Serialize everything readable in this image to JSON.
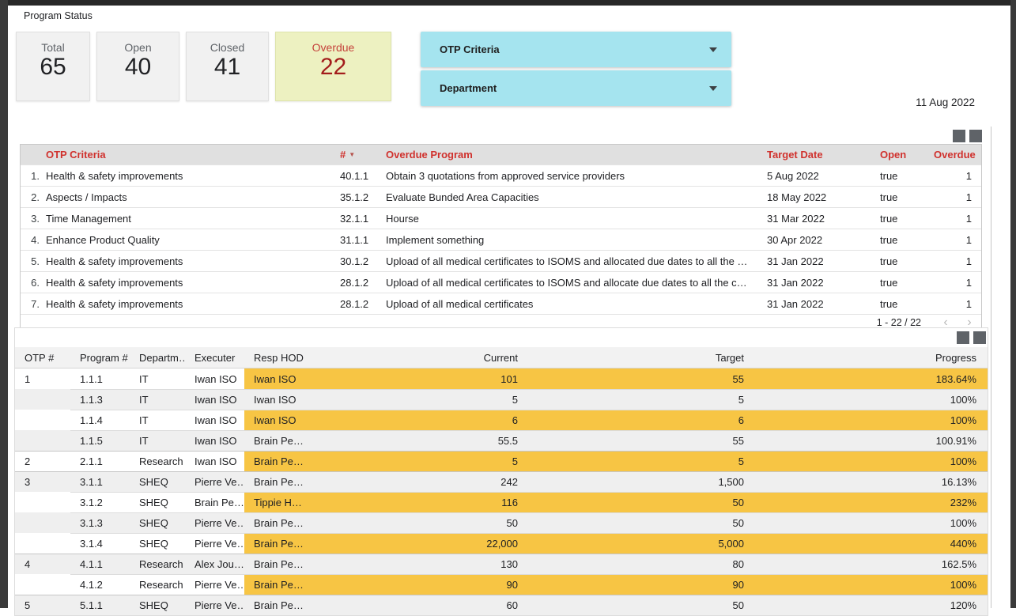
{
  "page": {
    "title": "Program Status",
    "date": "11 Aug 2022"
  },
  "scorecards": [
    {
      "label": "Total",
      "value": "65",
      "variant": "default"
    },
    {
      "label": "Open",
      "value": "40",
      "variant": "default"
    },
    {
      "label": "Closed",
      "value": "41",
      "variant": "default"
    },
    {
      "label": "Overdue",
      "value": "22",
      "variant": "overdue"
    }
  ],
  "filters": [
    {
      "label": "OTP Criteria"
    },
    {
      "label": "Department"
    }
  ],
  "overdue_table": {
    "headers": {
      "criteria": "OTP Criteria",
      "hash": "#",
      "program": "Overdue Program",
      "target_date": "Target Date",
      "open": "Open",
      "overdue": "Overdue"
    },
    "sort_icon": "▼",
    "rows": [
      {
        "num": "1.",
        "criteria": "Health & safety improvements",
        "hash": "40.1.1",
        "program": "Obtain 3 quotations from approved service providers",
        "target_date": "5 Aug 2022",
        "open": "true",
        "overdue": "1"
      },
      {
        "num": "2.",
        "criteria": "Aspects / Impacts",
        "hash": "35.1.2",
        "program": "Evaluate Bunded Area Capacities",
        "target_date": "18 May 2022",
        "open": "true",
        "overdue": "1"
      },
      {
        "num": "3.",
        "criteria": "Time Management",
        "hash": "32.1.1",
        "program": "Hourse",
        "target_date": "31 Mar 2022",
        "open": "true",
        "overdue": "1"
      },
      {
        "num": "4.",
        "criteria": "Enhance Product Quality",
        "hash": "31.1.1",
        "program": "Implement something",
        "target_date": "30 Apr 2022",
        "open": "true",
        "overdue": "1"
      },
      {
        "num": "5.",
        "criteria": "Health & safety improvements",
        "hash": "30.1.2",
        "program": "Upload of all medical certificates to ISOMS and allocated due dates to all the …",
        "target_date": "31 Jan 2022",
        "open": "true",
        "overdue": "1"
      },
      {
        "num": "6.",
        "criteria": "Health & safety improvements",
        "hash": "28.1.2",
        "program": "Upload of all medical certificates to ISOMS and allocate due dates to all the c…",
        "target_date": "31 Jan 2022",
        "open": "true",
        "overdue": "1"
      },
      {
        "num": "7.",
        "criteria": "Health & safety improvements",
        "hash": "28.1.2",
        "program": "Upload of all medical certificates",
        "target_date": "31 Jan 2022",
        "open": "true",
        "overdue": "1"
      }
    ],
    "pagination": {
      "range": "1 - 22 / 22",
      "prev": "‹",
      "next": "›"
    }
  },
  "progress_table": {
    "headers": {
      "otp": "OTP #",
      "program": "Program #",
      "department": "Departm…",
      "executer": "Executer",
      "resp_hod": "Resp HOD",
      "current": "Current",
      "target": "Target",
      "progress": "Progress"
    },
    "rows": [
      {
        "otp": "1",
        "program": "1.1.1",
        "department": "IT",
        "executer": "Iwan ISO",
        "resp_hod": "Iwan ISO",
        "current": "101",
        "target": "55",
        "progress": "183.64%",
        "highlight": true,
        "shaded": false,
        "group": false
      },
      {
        "otp": "",
        "program": "1.1.3",
        "department": "IT",
        "executer": "Iwan ISO",
        "resp_hod": "Iwan ISO",
        "current": "5",
        "target": "5",
        "progress": "100%",
        "highlight": false,
        "shaded": true,
        "group": false
      },
      {
        "otp": "",
        "program": "1.1.4",
        "department": "IT",
        "executer": "Iwan ISO",
        "resp_hod": "Iwan ISO",
        "current": "6",
        "target": "6",
        "progress": "100%",
        "highlight": true,
        "shaded": false,
        "group": false
      },
      {
        "otp": "",
        "program": "1.1.5",
        "department": "IT",
        "executer": "Iwan ISO",
        "resp_hod": "Brain Pe…",
        "current": "55.5",
        "target": "55",
        "progress": "100.91%",
        "highlight": false,
        "shaded": true,
        "group": false
      },
      {
        "otp": "2",
        "program": "2.1.1",
        "department": "Research",
        "executer": "Iwan ISO",
        "resp_hod": "Brain Pe…",
        "current": "5",
        "target": "5",
        "progress": "100%",
        "highlight": true,
        "shaded": false,
        "group": true
      },
      {
        "otp": "3",
        "program": "3.1.1",
        "department": "SHEQ",
        "executer": "Pierre Ve…",
        "resp_hod": "Brain Pe…",
        "current": "242",
        "target": "1,500",
        "progress": "16.13%",
        "highlight": false,
        "shaded": true,
        "group": true
      },
      {
        "otp": "",
        "program": "3.1.2",
        "department": "SHEQ",
        "executer": "Brain Pe…",
        "resp_hod": "Tippie H…",
        "current": "116",
        "target": "50",
        "progress": "232%",
        "highlight": true,
        "shaded": false,
        "group": false
      },
      {
        "otp": "",
        "program": "3.1.3",
        "department": "SHEQ",
        "executer": "Pierre Ve…",
        "resp_hod": "Brain Pe…",
        "current": "50",
        "target": "50",
        "progress": "100%",
        "highlight": false,
        "shaded": true,
        "group": false
      },
      {
        "otp": "",
        "program": "3.1.4",
        "department": "SHEQ",
        "executer": "Pierre Ve…",
        "resp_hod": "Brain Pe…",
        "current": "22,000",
        "target": "5,000",
        "progress": "440%",
        "highlight": true,
        "shaded": false,
        "group": false
      },
      {
        "otp": "4",
        "program": "4.1.1",
        "department": "Research",
        "executer": "Alex Jou…",
        "resp_hod": "Brain Pe…",
        "current": "130",
        "target": "80",
        "progress": "162.5%",
        "highlight": false,
        "shaded": true,
        "group": true
      },
      {
        "otp": "",
        "program": "4.1.2",
        "department": "Research",
        "executer": "Pierre Ve…",
        "resp_hod": "Brain Pe…",
        "current": "90",
        "target": "90",
        "progress": "100%",
        "highlight": true,
        "shaded": false,
        "group": false
      },
      {
        "otp": "5",
        "program": "5.1.1",
        "department": "SHEQ",
        "executer": "Pierre Ve…",
        "resp_hod": "Brain Pe…",
        "current": "60",
        "target": "50",
        "progress": "120%",
        "highlight": false,
        "shaded": true,
        "group": true
      }
    ]
  },
  "colors": {
    "highlight_yellow": "#f7c544",
    "filter_cyan": "#a5e4ef",
    "table_header_red": "#d0312d",
    "overdue_card_bg": "#edf1c1",
    "overdue_value_red": "#a31d1c",
    "shaded_row_gray": "#efefef",
    "frame_dark": "#3a3a3a"
  }
}
